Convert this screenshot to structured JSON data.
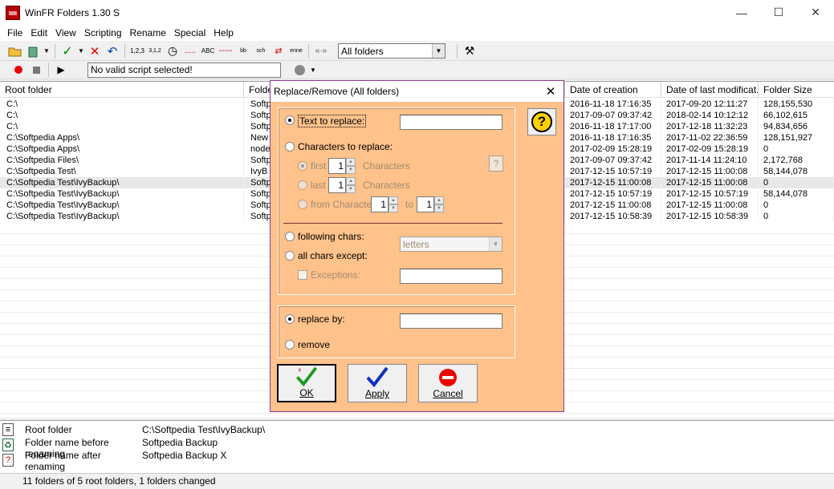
{
  "window": {
    "title": "WinFR Folders 1.30 S",
    "minimize": "—",
    "maximize": "☐",
    "close": "✕"
  },
  "menu": [
    "File",
    "Edit",
    "View",
    "Scripting",
    "Rename",
    "Special",
    "Help"
  ],
  "toolbar": {
    "folder_filter": "All folders",
    "script_status": "No valid script selected!"
  },
  "table": {
    "columns": [
      "Root folder",
      "Folde",
      "Date of creation",
      "Date of last modificat...",
      "Folder Size"
    ],
    "rows": [
      [
        "C:\\",
        "Softp",
        "2016-11-18 17:16:35",
        "2017-09-20 12:11:27",
        "128,155,530"
      ],
      [
        "C:\\",
        "Softp",
        "2017-09-07 09:37:42",
        "2018-02-14 10:12:12",
        "66,102,615"
      ],
      [
        "C:\\",
        "Softp",
        "2016-11-18 17:17:00",
        "2017-12-18 11:32:23",
        "94,834,656"
      ],
      [
        "C:\\Softpedia Apps\\",
        "New",
        "2016-11-18 17:16:35",
        "2017-11-02 22:36:59",
        "128,151,927"
      ],
      [
        "C:\\Softpedia Apps\\",
        "node",
        "2017-02-09 15:28:19",
        "2017-02-09 15:28:19",
        "0"
      ],
      [
        "C:\\Softpedia Files\\",
        "Softp",
        "2017-09-07 09:37:42",
        "2017-11-14 11:24:10",
        "2,172,768"
      ],
      [
        "C:\\Softpedia Test\\",
        "IvyB",
        "2017-12-15 10:57:19",
        "2017-12-15 11:00:08",
        "58,144,078"
      ],
      [
        "C:\\Softpedia Test\\IvyBackup\\",
        "Softp",
        "2017-12-15 11:00:08",
        "2017-12-15 11:00:08",
        "0"
      ],
      [
        "C:\\Softpedia Test\\IvyBackup\\",
        "Softp",
        "2017-12-15 10:57:19",
        "2017-12-15 10:57:19",
        "58,144,078"
      ],
      [
        "C:\\Softpedia Test\\IvyBackup\\",
        "Softp",
        "2017-12-15 11:00:08",
        "2017-12-15 11:00:08",
        "0"
      ],
      [
        "C:\\Softpedia Test\\IvyBackup\\",
        "Softp",
        "2017-12-15 10:58:39",
        "2017-12-15 10:58:39",
        "0"
      ]
    ],
    "selected_row": 7
  },
  "info": {
    "root_label": "Root folder",
    "root_value": "C:\\Softpedia Test\\IvyBackup\\",
    "before_label": "Folder name before renaming",
    "before_value": "Softpedia Backup",
    "after_label": "Folder name after renaming",
    "after_value": "Softpedia Backup X"
  },
  "status": "11 folders of 5 root folders, 1 folders changed",
  "dialog": {
    "title": "Replace/Remove (All folders)",
    "close": "✕",
    "text_to_replace": "Text to replace:",
    "chars_to_replace": "Characters to replace:",
    "first": "first",
    "last": "last",
    "from_character": "from Character",
    "to": "to",
    "characters": "Characters",
    "first_value": "1",
    "last_value": "1",
    "from_value": "1",
    "to_value": "1",
    "following_chars": "following chars:",
    "all_chars_except": "all chars except:",
    "letters": "letters",
    "exceptions": "Exceptions:",
    "replace_by": "replace by:",
    "remove": "remove",
    "ok": "OK",
    "apply": "Apply",
    "cancel": "Cancel",
    "help": "?"
  }
}
